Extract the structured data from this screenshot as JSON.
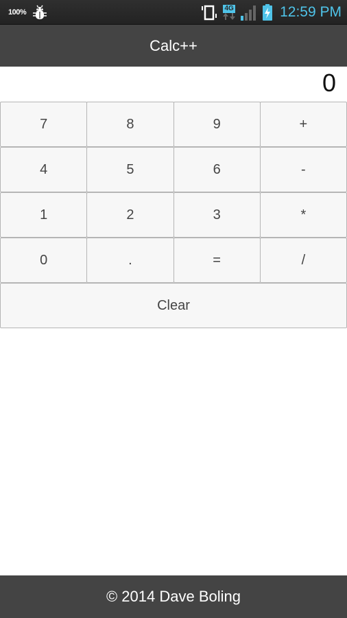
{
  "status_bar": {
    "battery_percent": "100%",
    "network_type": "4G",
    "time": "12:59 PM",
    "icons": [
      "debug-bug-icon",
      "vibrate-icon",
      "4g-data-icon",
      "signal-icon",
      "battery-charging-icon"
    ]
  },
  "app": {
    "title": "Calc++"
  },
  "display": {
    "value": "0"
  },
  "keypad": {
    "rows": [
      [
        "7",
        "8",
        "9",
        "+"
      ],
      [
        "4",
        "5",
        "6",
        "-"
      ],
      [
        "1",
        "2",
        "3",
        "*"
      ],
      [
        "0",
        ".",
        "=",
        "/"
      ]
    ],
    "clear_label": "Clear"
  },
  "footer": {
    "text": "© 2014 Dave Boling"
  },
  "colors": {
    "bar_background": "#444444",
    "status_accent": "#4fc3e8",
    "key_background": "#f7f7f7",
    "key_border": "#b5b5b5"
  }
}
